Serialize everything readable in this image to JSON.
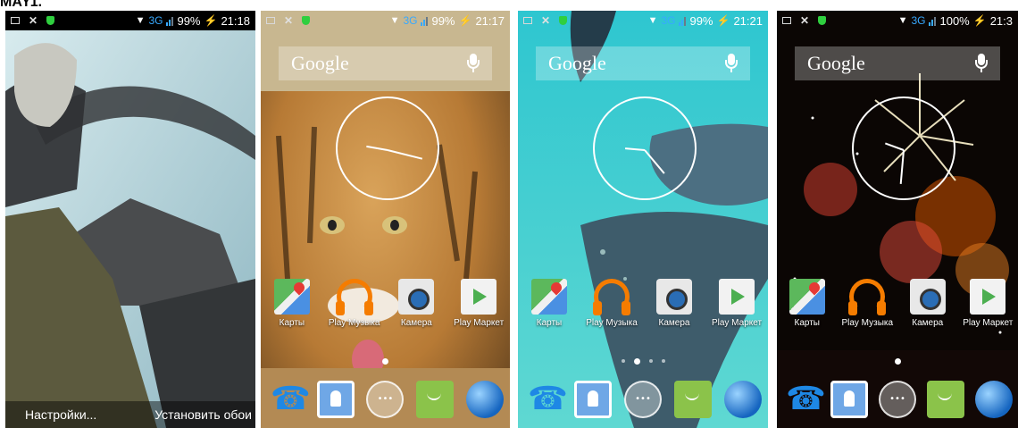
{
  "caption": "МАҮ1.",
  "screens": [
    {
      "status": {
        "network": "3G",
        "battery": "99%",
        "time": "21:18"
      },
      "actions": {
        "settings_label": "Настройки...",
        "set_wallpaper_label": "Установить обои"
      }
    },
    {
      "status": {
        "network": "3G",
        "battery": "99%",
        "time": "21:17"
      },
      "search": {
        "logo": "Google"
      },
      "apps": [
        "Карты",
        "Play Музыка",
        "Камера",
        "Play Маркет"
      ]
    },
    {
      "status": {
        "network": "3G",
        "battery": "99%",
        "time": "21:21"
      },
      "search": {
        "logo": "Google"
      },
      "apps": [
        "Карты",
        "Play Музыка",
        "Камера",
        "Play Маркет"
      ]
    },
    {
      "status": {
        "network": "3G",
        "battery": "100%",
        "time": "21:3"
      },
      "search": {
        "logo": "Google"
      },
      "apps": [
        "Карты",
        "Play Музыка",
        "Камера",
        "Play Маркет"
      ]
    }
  ],
  "colors": {
    "status_network": "#37a9ff",
    "label_text": "#ffffff"
  }
}
